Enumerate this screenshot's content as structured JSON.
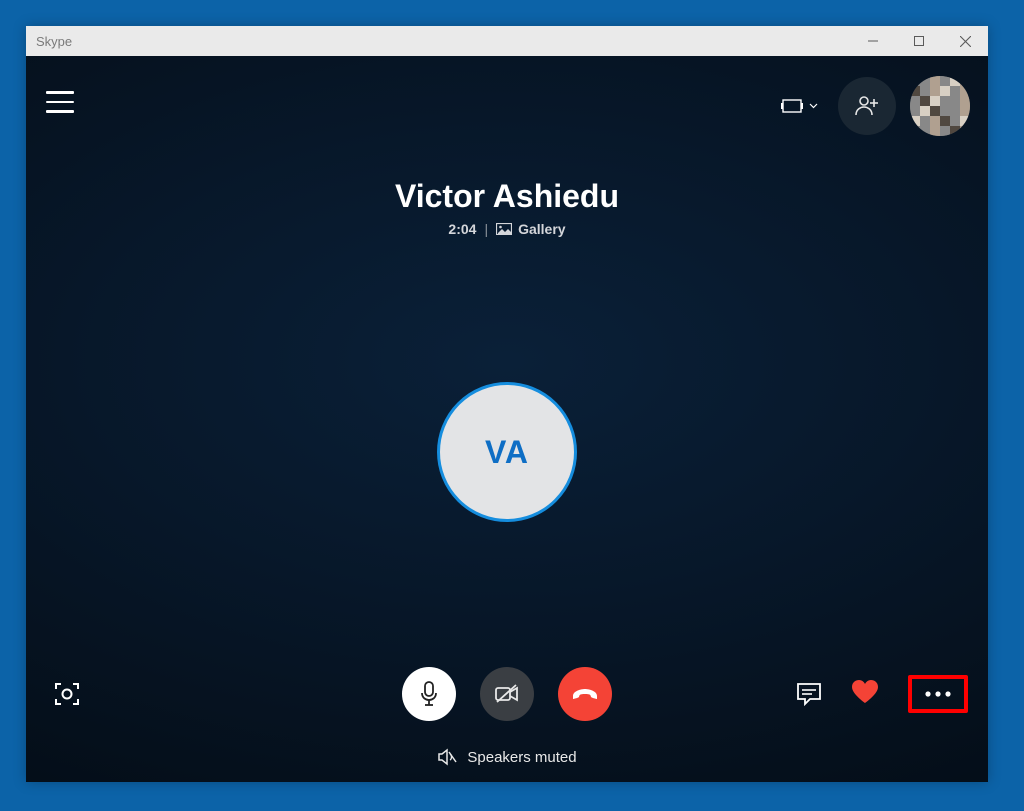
{
  "window": {
    "title": "Skype"
  },
  "header": {
    "icons": {
      "menu": "menu",
      "snap": "snap-layout",
      "add_people": "add-people"
    }
  },
  "call": {
    "name": "Victor Ashiedu",
    "duration": "2:04",
    "view_mode": "Gallery",
    "avatar_initials": "VA"
  },
  "controls": {
    "snapshot": "snapshot",
    "mic": "microphone",
    "camera": "camera-off",
    "end": "end-call",
    "chat": "chat",
    "react": "heart",
    "more": "more"
  },
  "status": {
    "text": "Speakers muted",
    "icon": "speaker-muted"
  },
  "colors": {
    "background_desktop": "#0c63a8",
    "call_bg": "#05101c",
    "end_call": "#f44336",
    "accent": "#158dde",
    "highlight": "#ff0000"
  }
}
